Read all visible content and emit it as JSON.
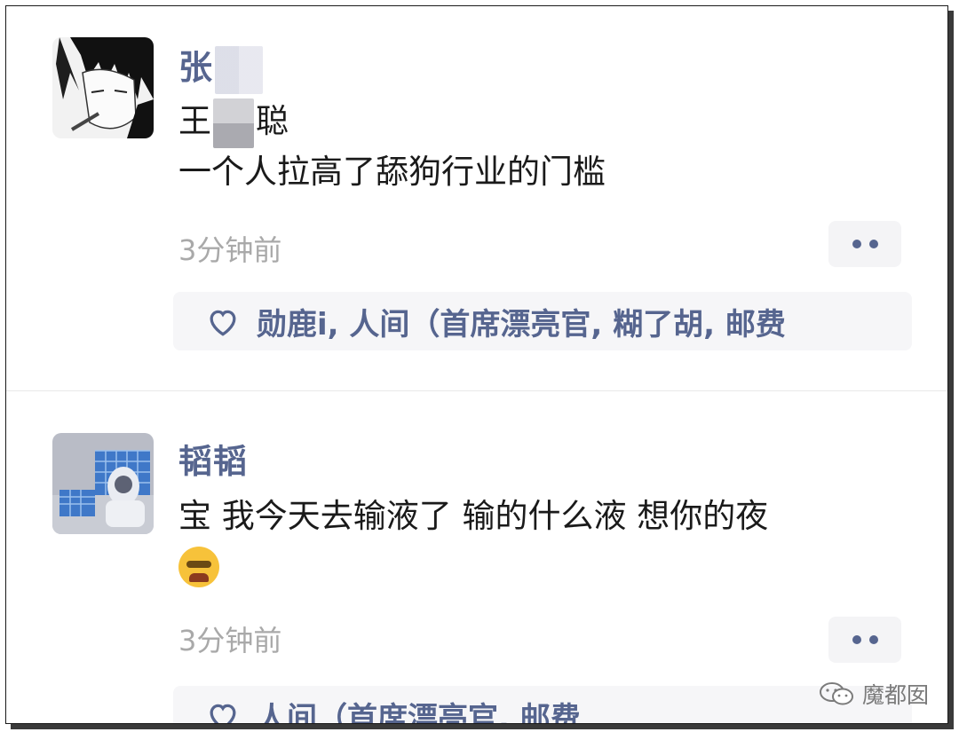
{
  "comments": [
    {
      "username": "张",
      "content_name_prefix": "王",
      "content_name_suffix": "聪",
      "content_line2": "一个人拉高了舔狗行业的门槛",
      "timestamp": "3分钟前",
      "likes_text": "勋鹿i, 人间（首席漂亮官, 糊了胡, 邮费"
    },
    {
      "username": "韬韬",
      "content_line1": "宝 我今天去输液了 输的什么液 想你的夜",
      "emoji_icon": "crying-face-emoji",
      "timestamp": "3分钟前",
      "likes_text": "人间（首席漂亮官, 邮费"
    }
  ],
  "icons": {
    "heart": "heart-outline-icon",
    "more": "more-dots-icon",
    "wechat": "wechat-icon"
  },
  "watermark": {
    "text": "魔都囡"
  },
  "colors": {
    "username": "#56658f",
    "content": "#1a1a1a",
    "timestamp": "#a9a9a9",
    "likes_bg": "#f6f6f8"
  }
}
